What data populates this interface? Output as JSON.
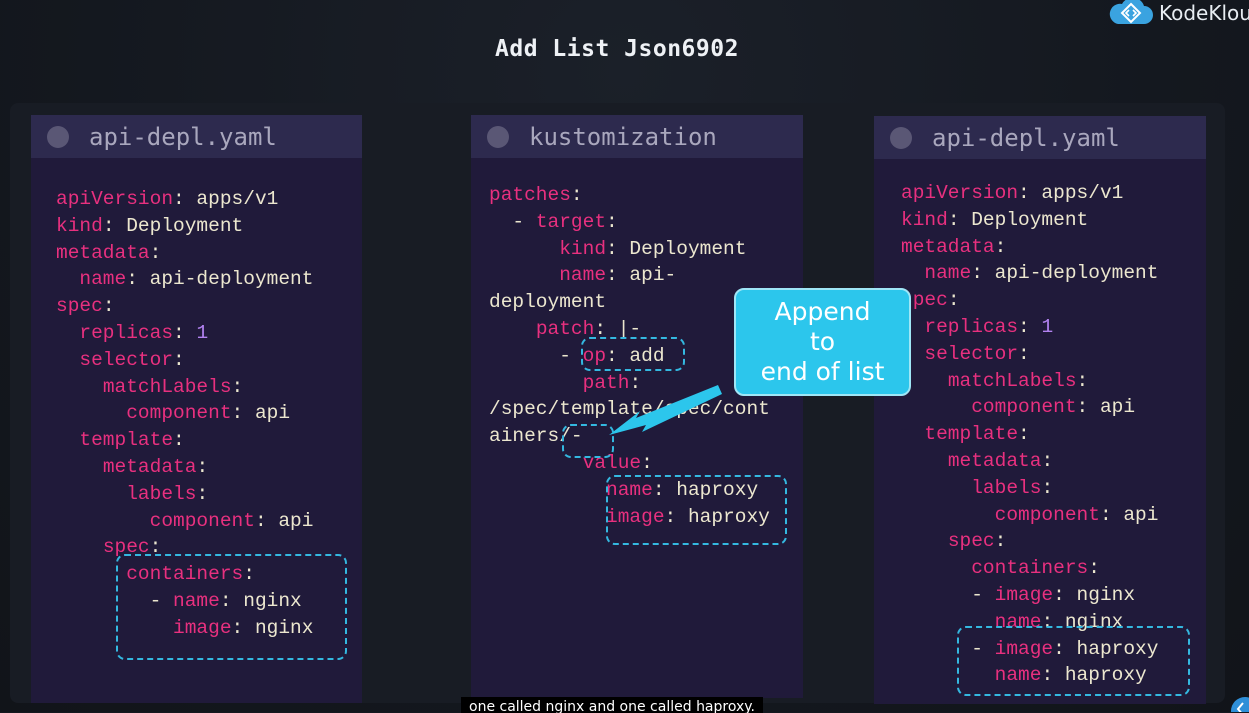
{
  "slide": {
    "title": "Add List Json6902"
  },
  "brand": {
    "name": "KodeKlou",
    "logo_icon": "kodekloud-cloud-icon"
  },
  "panels": {
    "left": {
      "title": "api-depl.yaml",
      "lines": [
        [
          {
            "t": "k",
            "s": "apiVersion"
          },
          {
            "t": "v",
            "s": ": apps/v1"
          }
        ],
        [
          {
            "t": "k",
            "s": "kind"
          },
          {
            "t": "v",
            "s": ": Deployment"
          }
        ],
        [
          {
            "t": "k",
            "s": "metadata"
          },
          {
            "t": "v",
            "s": ":"
          }
        ],
        [
          {
            "t": "v",
            "s": "  "
          },
          {
            "t": "k",
            "s": "name"
          },
          {
            "t": "v",
            "s": ": api-deployment"
          }
        ],
        [
          {
            "t": "k",
            "s": "spec"
          },
          {
            "t": "v",
            "s": ":"
          }
        ],
        [
          {
            "t": "v",
            "s": "  "
          },
          {
            "t": "k",
            "s": "replicas"
          },
          {
            "t": "v",
            "s": ": "
          },
          {
            "t": "n",
            "s": "1"
          }
        ],
        [
          {
            "t": "v",
            "s": "  "
          },
          {
            "t": "k",
            "s": "selector"
          },
          {
            "t": "v",
            "s": ":"
          }
        ],
        [
          {
            "t": "v",
            "s": "    "
          },
          {
            "t": "k",
            "s": "matchLabels"
          },
          {
            "t": "v",
            "s": ":"
          }
        ],
        [
          {
            "t": "v",
            "s": "      "
          },
          {
            "t": "k",
            "s": "component"
          },
          {
            "t": "v",
            "s": ": api"
          }
        ],
        [
          {
            "t": "v",
            "s": "  "
          },
          {
            "t": "k",
            "s": "template"
          },
          {
            "t": "v",
            "s": ":"
          }
        ],
        [
          {
            "t": "v",
            "s": "    "
          },
          {
            "t": "k",
            "s": "metadata"
          },
          {
            "t": "v",
            "s": ":"
          }
        ],
        [
          {
            "t": "v",
            "s": "      "
          },
          {
            "t": "k",
            "s": "labels"
          },
          {
            "t": "v",
            "s": ":"
          }
        ],
        [
          {
            "t": "v",
            "s": "        "
          },
          {
            "t": "k",
            "s": "component"
          },
          {
            "t": "v",
            "s": ": api"
          }
        ],
        [
          {
            "t": "v",
            "s": "    "
          },
          {
            "t": "k",
            "s": "spec"
          },
          {
            "t": "v",
            "s": ":"
          }
        ],
        [
          {
            "t": "v",
            "s": "      "
          },
          {
            "t": "k",
            "s": "containers"
          },
          {
            "t": "v",
            "s": ":"
          }
        ],
        [
          {
            "t": "v",
            "s": "        - "
          },
          {
            "t": "k",
            "s": "name"
          },
          {
            "t": "v",
            "s": ": nginx"
          }
        ],
        [
          {
            "t": "v",
            "s": "          "
          },
          {
            "t": "k",
            "s": "image"
          },
          {
            "t": "v",
            "s": ": nginx"
          }
        ]
      ]
    },
    "middle": {
      "title": "kustomization",
      "lines": [
        [
          {
            "t": "k",
            "s": "patches"
          },
          {
            "t": "v",
            "s": ":"
          }
        ],
        [
          {
            "t": "v",
            "s": "  - "
          },
          {
            "t": "k",
            "s": "target"
          },
          {
            "t": "v",
            "s": ":"
          }
        ],
        [
          {
            "t": "v",
            "s": "      "
          },
          {
            "t": "k",
            "s": "kind"
          },
          {
            "t": "v",
            "s": ": Deployment"
          }
        ],
        [
          {
            "t": "v",
            "s": "      "
          },
          {
            "t": "k",
            "s": "name"
          },
          {
            "t": "v",
            "s": ": api-"
          }
        ],
        [
          {
            "t": "v",
            "s": "deployment"
          }
        ],
        [
          {
            "t": "v",
            "s": "    "
          },
          {
            "t": "k",
            "s": "patch"
          },
          {
            "t": "v",
            "s": ": |-"
          }
        ],
        [
          {
            "t": "v",
            "s": "      - "
          },
          {
            "t": "k",
            "s": "op"
          },
          {
            "t": "v",
            "s": ": add"
          }
        ],
        [
          {
            "t": "v",
            "s": "        "
          },
          {
            "t": "k",
            "s": "path"
          },
          {
            "t": "v",
            "s": ":"
          }
        ],
        [
          {
            "t": "v",
            "s": "/spec/template/spec/cont"
          }
        ],
        [
          {
            "t": "v",
            "s": "ainers/-"
          }
        ],
        [
          {
            "t": "v",
            "s": "        "
          },
          {
            "t": "k",
            "s": "value"
          },
          {
            "t": "v",
            "s": ":"
          }
        ],
        [
          {
            "t": "v",
            "s": "          "
          },
          {
            "t": "k",
            "s": "name"
          },
          {
            "t": "v",
            "s": ": haproxy"
          }
        ],
        [
          {
            "t": "v",
            "s": "          "
          },
          {
            "t": "k",
            "s": "image"
          },
          {
            "t": "v",
            "s": ": haproxy"
          }
        ]
      ]
    },
    "right": {
      "title": "api-depl.yaml",
      "lines": [
        [
          {
            "t": "k",
            "s": "apiVersion"
          },
          {
            "t": "v",
            "s": ": apps/v1"
          }
        ],
        [
          {
            "t": "k",
            "s": "kind"
          },
          {
            "t": "v",
            "s": ": Deployment"
          }
        ],
        [
          {
            "t": "k",
            "s": "metadata"
          },
          {
            "t": "v",
            "s": ":"
          }
        ],
        [
          {
            "t": "v",
            "s": "  "
          },
          {
            "t": "k",
            "s": "name"
          },
          {
            "t": "v",
            "s": ": api-deployment"
          }
        ],
        [
          {
            "t": "k",
            "s": "spec"
          },
          {
            "t": "v",
            "s": ":"
          }
        ],
        [
          {
            "t": "v",
            "s": "  "
          },
          {
            "t": "k",
            "s": "replicas"
          },
          {
            "t": "v",
            "s": ": "
          },
          {
            "t": "n",
            "s": "1"
          }
        ],
        [
          {
            "t": "v",
            "s": "  "
          },
          {
            "t": "k",
            "s": "selector"
          },
          {
            "t": "v",
            "s": ":"
          }
        ],
        [
          {
            "t": "v",
            "s": "    "
          },
          {
            "t": "k",
            "s": "matchLabels"
          },
          {
            "t": "v",
            "s": ":"
          }
        ],
        [
          {
            "t": "v",
            "s": "      "
          },
          {
            "t": "k",
            "s": "component"
          },
          {
            "t": "v",
            "s": ": api"
          }
        ],
        [
          {
            "t": "v",
            "s": "  "
          },
          {
            "t": "k",
            "s": "template"
          },
          {
            "t": "v",
            "s": ":"
          }
        ],
        [
          {
            "t": "v",
            "s": "    "
          },
          {
            "t": "k",
            "s": "metadata"
          },
          {
            "t": "v",
            "s": ":"
          }
        ],
        [
          {
            "t": "v",
            "s": "      "
          },
          {
            "t": "k",
            "s": "labels"
          },
          {
            "t": "v",
            "s": ":"
          }
        ],
        [
          {
            "t": "v",
            "s": "        "
          },
          {
            "t": "k",
            "s": "component"
          },
          {
            "t": "v",
            "s": ": api"
          }
        ],
        [
          {
            "t": "v",
            "s": "    "
          },
          {
            "t": "k",
            "s": "spec"
          },
          {
            "t": "v",
            "s": ":"
          }
        ],
        [
          {
            "t": "v",
            "s": "      "
          },
          {
            "t": "k",
            "s": "containers"
          },
          {
            "t": "v",
            "s": ":"
          }
        ],
        [
          {
            "t": "v",
            "s": "      - "
          },
          {
            "t": "k",
            "s": "image"
          },
          {
            "t": "v",
            "s": ": nginx"
          }
        ],
        [
          {
            "t": "v",
            "s": "        "
          },
          {
            "t": "k",
            "s": "name"
          },
          {
            "t": "v",
            "s": ": nginx"
          }
        ],
        [
          {
            "t": "v",
            "s": "      - "
          },
          {
            "t": "k",
            "s": "image"
          },
          {
            "t": "v",
            "s": ": haproxy"
          }
        ],
        [
          {
            "t": "v",
            "s": "        "
          },
          {
            "t": "k",
            "s": "name"
          },
          {
            "t": "v",
            "s": ": haproxy"
          }
        ]
      ]
    }
  },
  "callout": {
    "text": "Append\nto\nend of list"
  },
  "caption": {
    "text": "one called nginx and one called haproxy."
  },
  "colors": {
    "key": "#e8307f",
    "value": "#ece7cf",
    "number": "#b282f0",
    "highlight": "#34b8e0",
    "callout": "#2cc6ec"
  }
}
